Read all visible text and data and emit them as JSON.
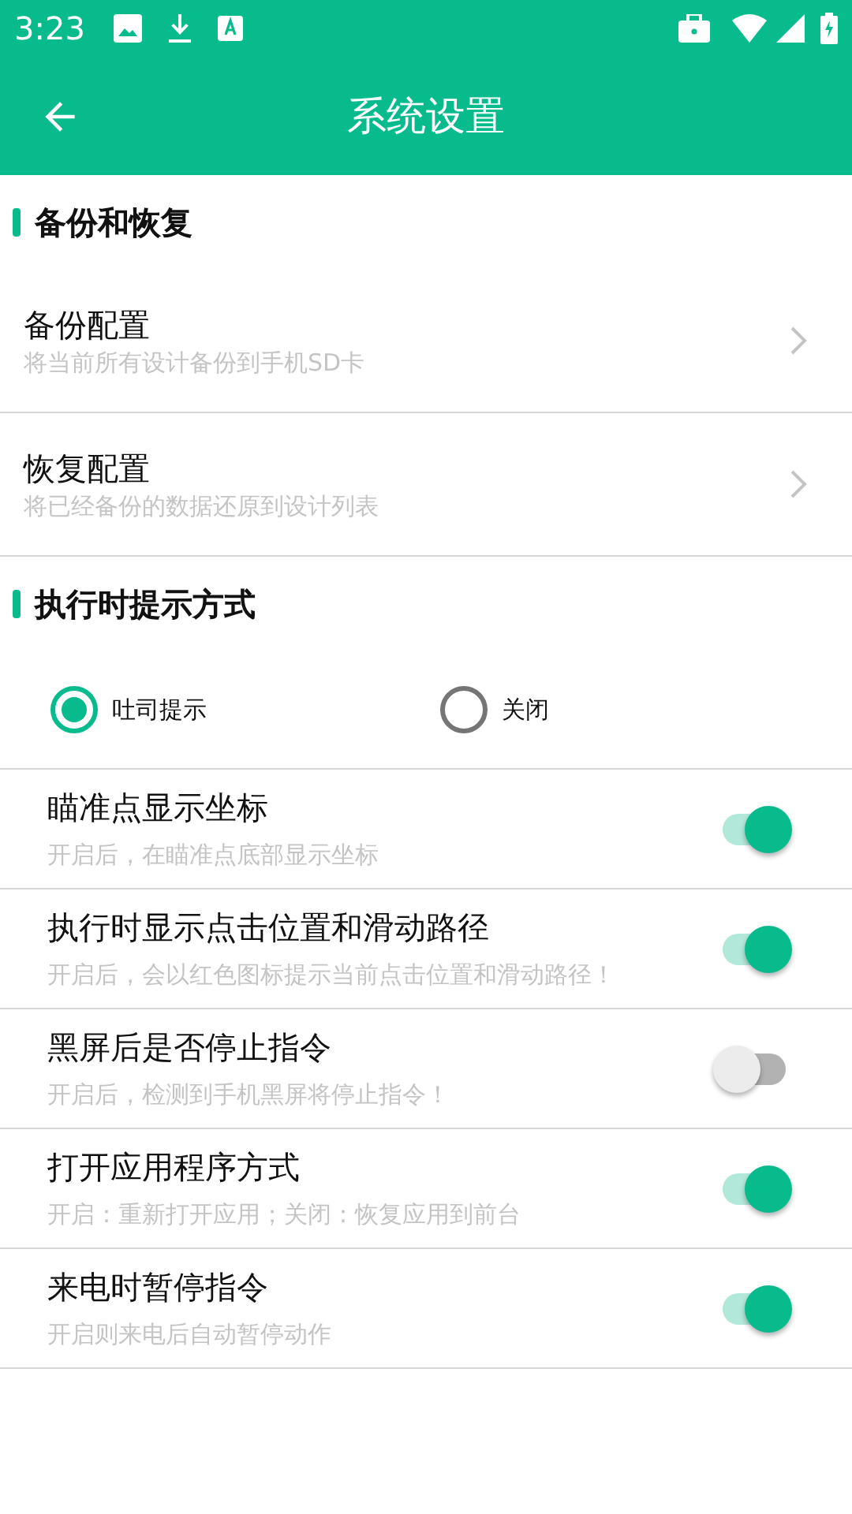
{
  "status_bar": {
    "time": "3:23"
  },
  "app_bar": {
    "title": "系统设置"
  },
  "sections": [
    {
      "title": "备份和恢复",
      "kind": "links",
      "items": [
        {
          "title": "备份配置",
          "subtitle": "将当前所有设计备份到手机SD卡"
        },
        {
          "title": "恢复配置",
          "subtitle": "将已经备份的数据还原到设计列表"
        }
      ]
    },
    {
      "title": "执行时提示方式",
      "kind": "radios",
      "options": [
        {
          "label": "吐司提示",
          "selected": true
        },
        {
          "label": "关闭",
          "selected": false
        }
      ]
    }
  ],
  "toggles": [
    {
      "title": "瞄准点显示坐标",
      "subtitle": "开启后，在瞄准点底部显示坐标",
      "on": true
    },
    {
      "title": "执行时显示点击位置和滑动路径",
      "subtitle": "开启后，会以红色图标提示当前点击位置和滑动路径！",
      "on": true
    },
    {
      "title": "黑屏后是否停止指令",
      "subtitle": "开启后，检测到手机黑屏将停止指令！",
      "on": false
    },
    {
      "title": "打开应用程序方式",
      "subtitle": "开启：重新打开应用；关闭：恢复应用到前台",
      "on": true
    },
    {
      "title": "来电时暂停指令",
      "subtitle": "开启则来电后自动暂停动作",
      "on": true
    }
  ]
}
